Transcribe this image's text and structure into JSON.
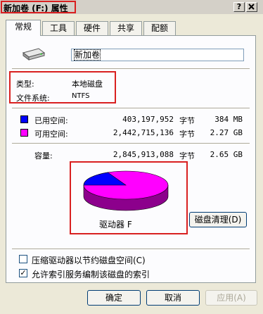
{
  "window": {
    "title": "新加卷 (F:) 属性",
    "help_label": "?",
    "close_label": "X"
  },
  "tabs": [
    {
      "label": "常规"
    },
    {
      "label": "工具"
    },
    {
      "label": "硬件"
    },
    {
      "label": "共享"
    },
    {
      "label": "配额"
    }
  ],
  "general": {
    "volume_name": "新加卷",
    "type_label": "类型:",
    "type_value": "本地磁盘",
    "fs_label": "文件系统:",
    "fs_value": "NTFS",
    "used": {
      "label": "已用空间:",
      "bytes": "403,197,952",
      "unit": "字节",
      "size": "384 MB",
      "color": "#0000ff"
    },
    "free": {
      "label": "可用空间:",
      "bytes": "2,442,715,136",
      "unit": "字节",
      "size": "2.27 GB",
      "color": "#ff00ff"
    },
    "capacity": {
      "label": "容量:",
      "bytes": "2,845,913,088",
      "unit": "字节",
      "size": "2.65 GB"
    },
    "drive_label": "驱动器 F",
    "cleanup_label": "磁盘清理(D)",
    "compress_label": "压缩驱动器以节约磁盘空间(C)",
    "compress_checked": false,
    "index_label": "允许索引服务编制该磁盘的索引",
    "index_checked": true
  },
  "buttons": {
    "ok": "确定",
    "cancel": "取消",
    "apply": "应用(A)"
  }
}
